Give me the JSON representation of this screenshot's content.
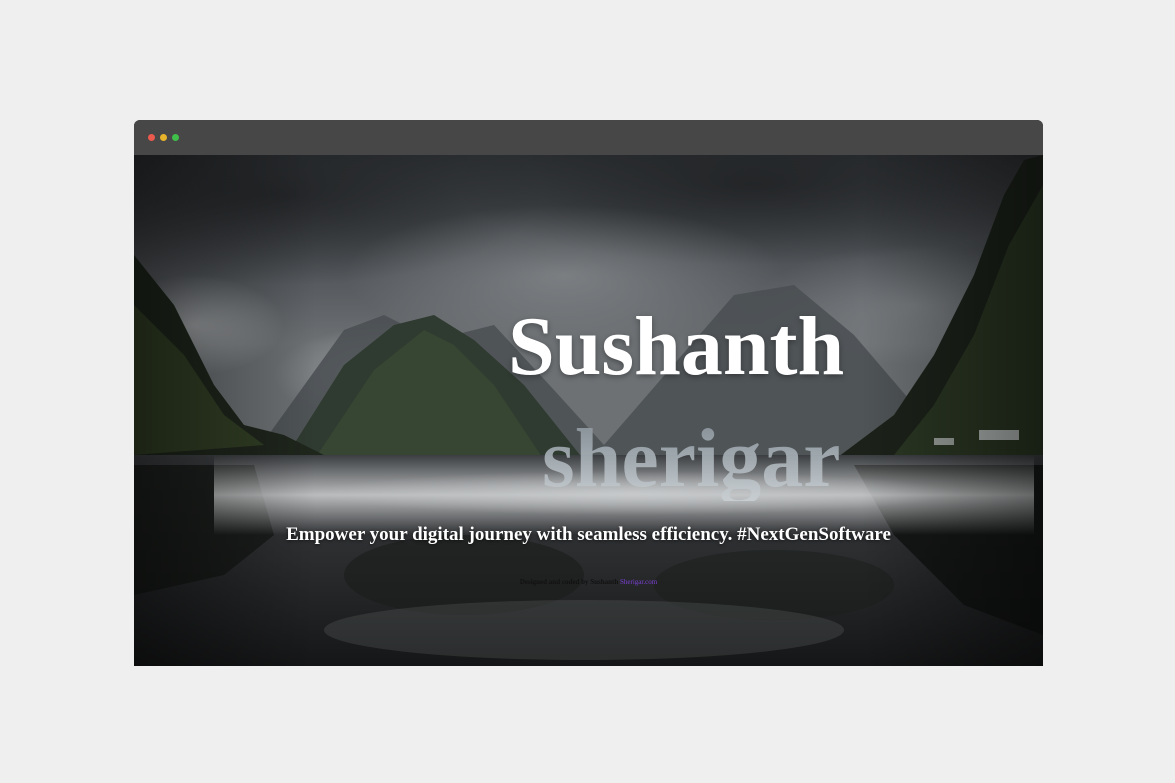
{
  "window": {
    "controls": [
      "close",
      "minimize",
      "maximize"
    ]
  },
  "hero": {
    "name_line1": "Sushanth",
    "name_line2": "sherigar",
    "tagline": "Empower your digital journey with seamless efficiency. #NextGenSoftware"
  },
  "footer": {
    "credit_text": "Designed and coded by Sushanth",
    "credit_link": "Sherigar.com"
  },
  "colors": {
    "page_bg": "#efefef",
    "titlebar": "#474747",
    "close": "#ec5a4e",
    "minimize": "#e6b32a",
    "maximize": "#3fbf4a",
    "link": "#7b3fd6"
  }
}
